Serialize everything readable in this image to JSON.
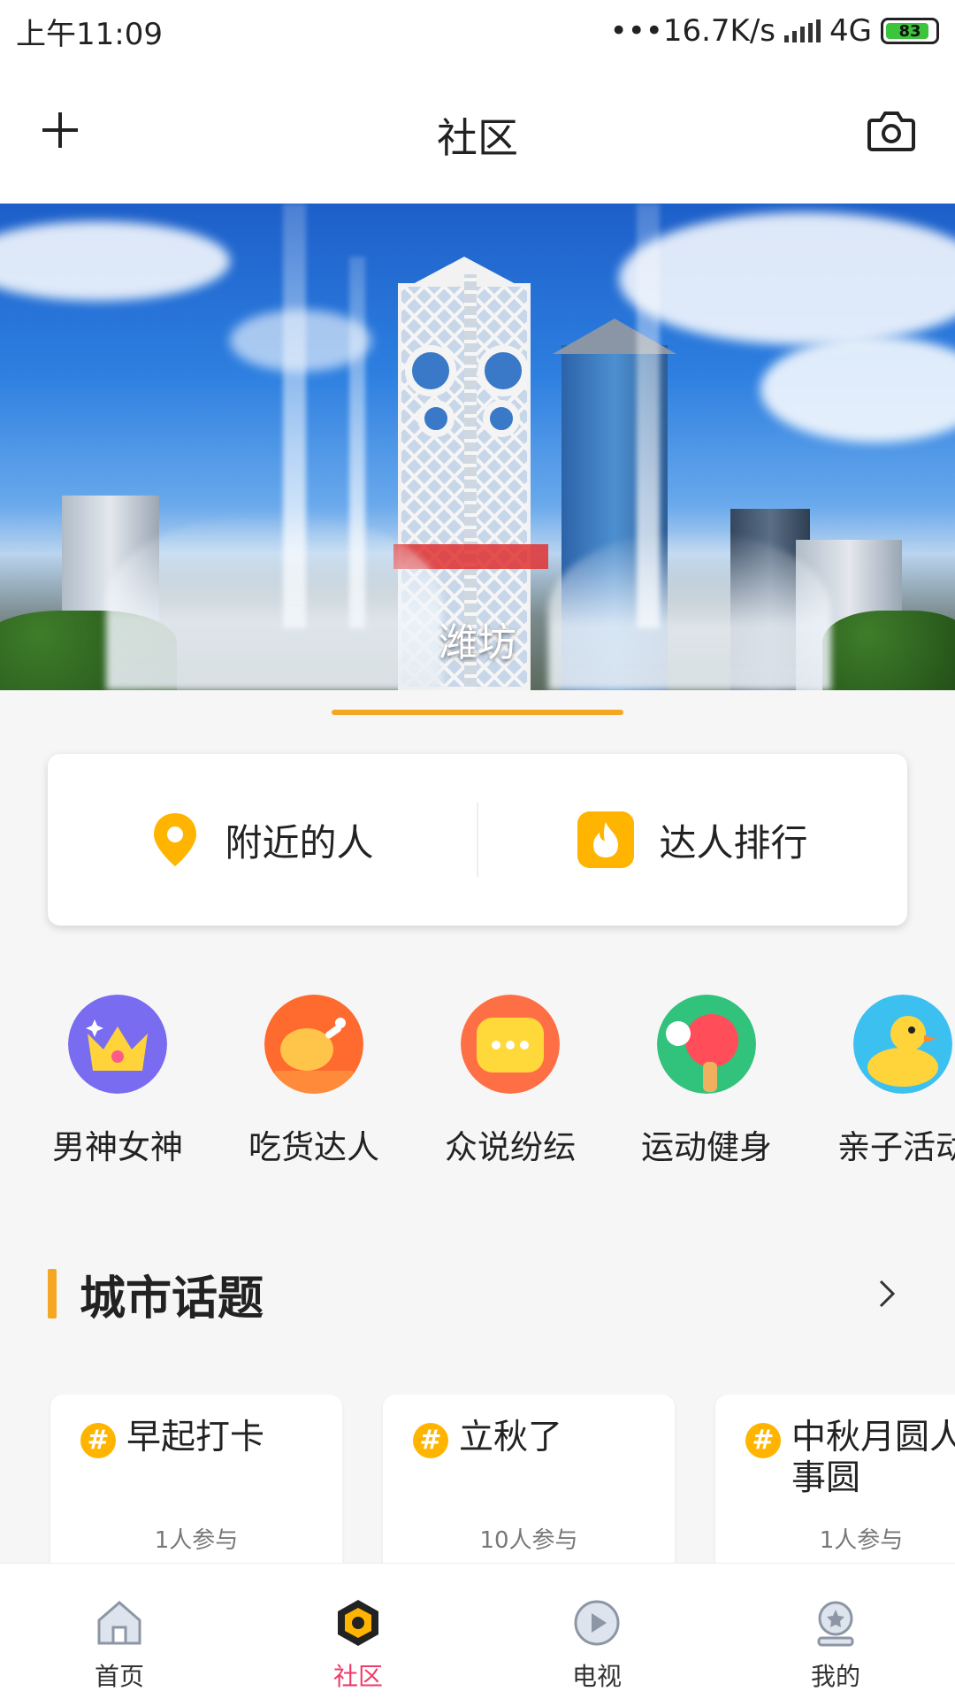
{
  "status_bar": {
    "time": "上午11:09",
    "net_speed": "•••16.7K/s",
    "network": "4G",
    "battery": "83"
  },
  "header": {
    "title": "社区",
    "left_icon": "plus-icon",
    "right_icon": "camera-icon"
  },
  "banner": {
    "caption": "潍坊"
  },
  "quick_actions": [
    {
      "label": "附近的人",
      "icon": "location-pin-icon",
      "color": "#ffb400"
    },
    {
      "label": "达人排行",
      "icon": "flame-icon",
      "color": "#ffb400"
    }
  ],
  "categories": [
    {
      "label": "男神女神",
      "icon": "crown-icon"
    },
    {
      "label": "吃货达人",
      "icon": "chicken-leg-icon"
    },
    {
      "label": "众说纷纭",
      "icon": "chat-bubble-icon"
    },
    {
      "label": "运动健身",
      "icon": "ping-pong-icon"
    },
    {
      "label": "亲子活动",
      "icon": "duck-icon"
    }
  ],
  "city_topics": {
    "title": "城市话题",
    "items": [
      {
        "name": "早起打卡",
        "count": "1人参与"
      },
      {
        "name": "立秋了",
        "count": "10人参与"
      },
      {
        "name": "中秋月圆人圆事圆",
        "count": "1人参与"
      }
    ]
  },
  "tab_bar": {
    "items": [
      {
        "label": "首页",
        "icon": "home-icon"
      },
      {
        "label": "社区",
        "icon": "community-icon",
        "active": true
      },
      {
        "label": "电视",
        "icon": "play-icon"
      },
      {
        "label": "我的",
        "icon": "profile-icon"
      }
    ]
  },
  "colors": {
    "accent": "#f5a623",
    "active_tab": "#ef3a6a"
  }
}
